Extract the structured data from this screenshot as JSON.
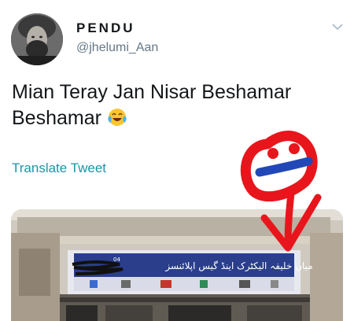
{
  "tweet": {
    "display_name": "PENDU",
    "handle": "@jhelumi_Aan",
    "text": "Mian Teray Jan Nisar Beshamar Beshamar",
    "emoji": "face-with-tears-of-joy",
    "translate_label": "Translate Tweet"
  },
  "media": {
    "sign_text": "میاں خلیفہ الیکٹرک اینڈ گیس اپلائنسز",
    "sign_number": "04"
  },
  "colors": {
    "link": "#1b95a8",
    "handle": "#657786",
    "doodle_red": "#e8161c",
    "doodle_blue": "#2248b8"
  }
}
